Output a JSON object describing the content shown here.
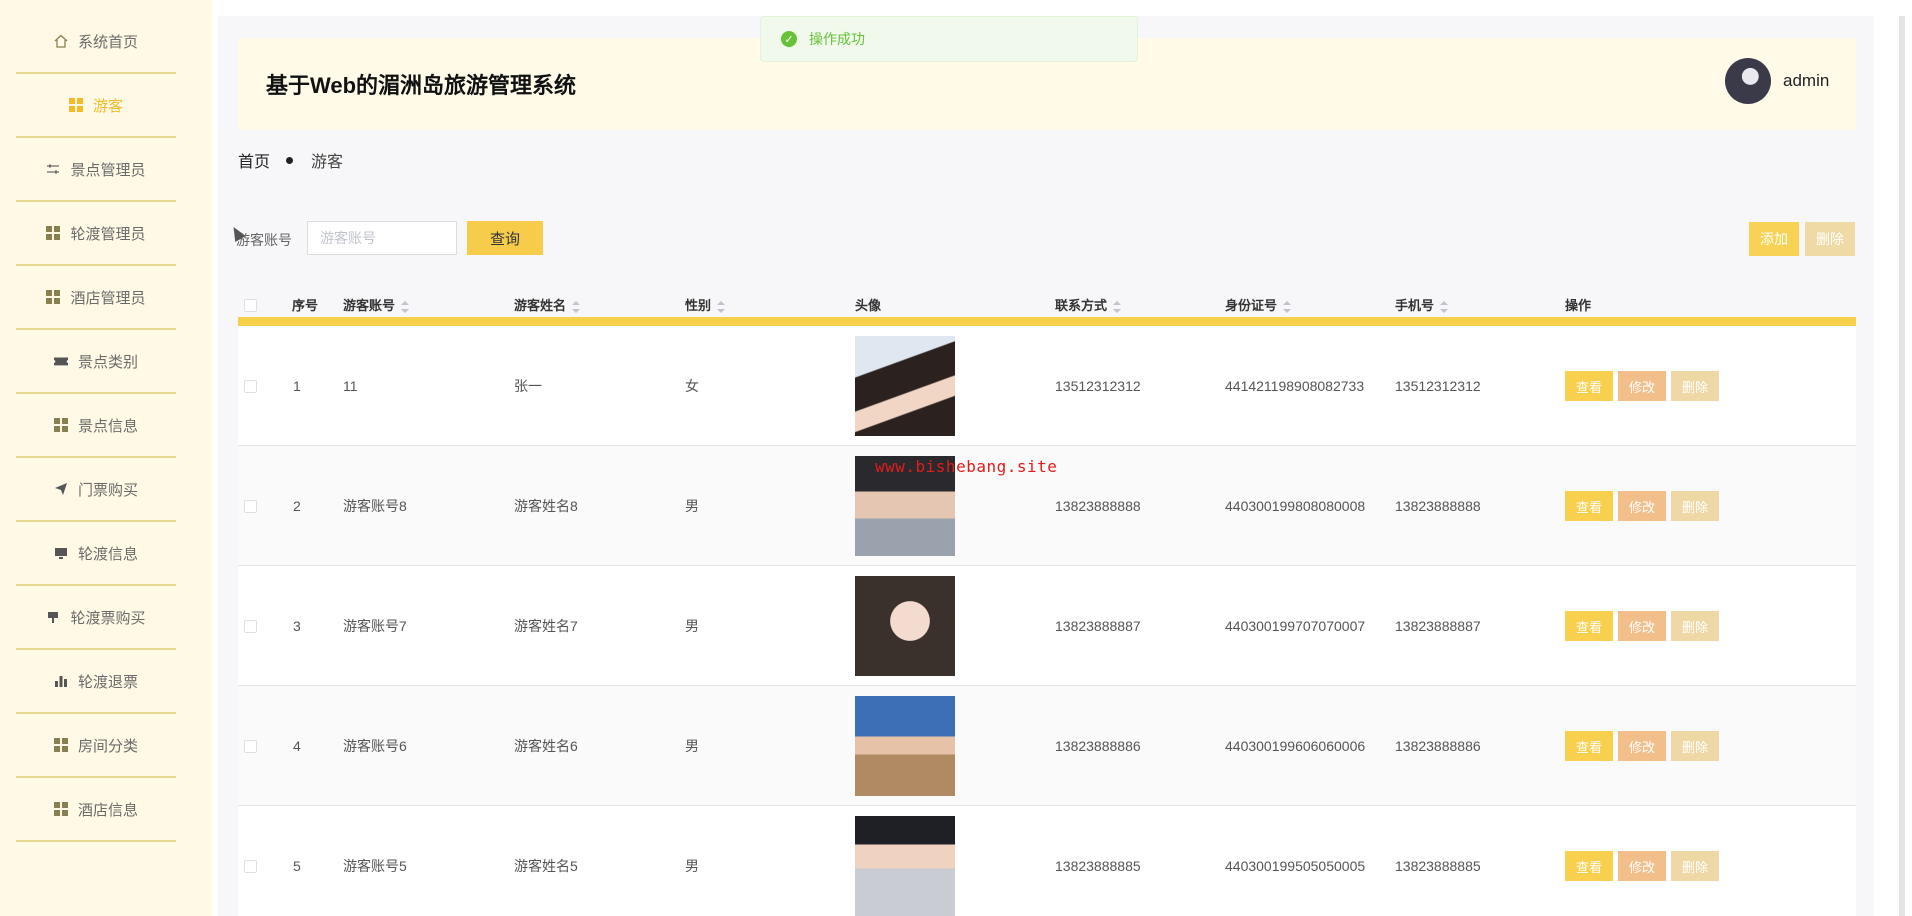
{
  "sidebar": {
    "items": [
      {
        "label": "系统首页",
        "icon": "home-icon"
      },
      {
        "label": "游客",
        "icon": "grid-icon",
        "active": true
      },
      {
        "label": "景点管理员",
        "icon": "sliders-icon"
      },
      {
        "label": "轮渡管理员",
        "icon": "grid-icon"
      },
      {
        "label": "酒店管理员",
        "icon": "grid-icon"
      },
      {
        "label": "景点类别",
        "icon": "ticket-icon"
      },
      {
        "label": "景点信息",
        "icon": "grid-icon"
      },
      {
        "label": "门票购买",
        "icon": "send-icon"
      },
      {
        "label": "轮渡信息",
        "icon": "monitor-icon"
      },
      {
        "label": "轮渡票购买",
        "icon": "cup-icon"
      },
      {
        "label": "轮渡退票",
        "icon": "bar-chart-icon"
      },
      {
        "label": "房间分类",
        "icon": "grid-icon"
      },
      {
        "label": "酒店信息",
        "icon": "grid-icon"
      }
    ]
  },
  "header": {
    "title": "基于Web的湄洲岛旅游管理系统",
    "username": "admin"
  },
  "toast": {
    "message": "操作成功"
  },
  "breadcrumb": {
    "home": "首页",
    "current": "游客"
  },
  "search": {
    "label": "游客账号",
    "placeholder": "游客账号",
    "button": "查询"
  },
  "actions": {
    "add": "添加",
    "delete": "删除"
  },
  "table": {
    "columns": [
      "序号",
      "游客账号",
      "游客姓名",
      "性别",
      "头像",
      "联系方式",
      "身份证号",
      "手机号",
      "操作"
    ],
    "row_buttons": {
      "view": "查看",
      "edit": "修改",
      "delete": "删除"
    },
    "rows": [
      {
        "index": "1",
        "account": "11",
        "name": "张一",
        "gender": "女",
        "contact": "13512312312",
        "id_card": "441421198908082733",
        "phone": "13512312312"
      },
      {
        "index": "2",
        "account": "游客账号8",
        "name": "游客姓名8",
        "gender": "男",
        "contact": "13823888888",
        "id_card": "440300199808080008",
        "phone": "13823888888"
      },
      {
        "index": "3",
        "account": "游客账号7",
        "name": "游客姓名7",
        "gender": "男",
        "contact": "13823888887",
        "id_card": "440300199707070007",
        "phone": "13823888887"
      },
      {
        "index": "4",
        "account": "游客账号6",
        "name": "游客姓名6",
        "gender": "男",
        "contact": "13823888886",
        "id_card": "440300199606060006",
        "phone": "13823888886"
      },
      {
        "index": "5",
        "account": "游客账号5",
        "name": "游客姓名5",
        "gender": "男",
        "contact": "13823888885",
        "id_card": "440300199505050005",
        "phone": "13823888885"
      }
    ]
  },
  "watermark": "www.bishebang.site",
  "colors": {
    "accent": "#f6cc4a",
    "active_menu": "#f3b926",
    "sidebar_bg": "#fff9e6",
    "header_bg": "#fffbe8",
    "success": "#67c23a"
  }
}
